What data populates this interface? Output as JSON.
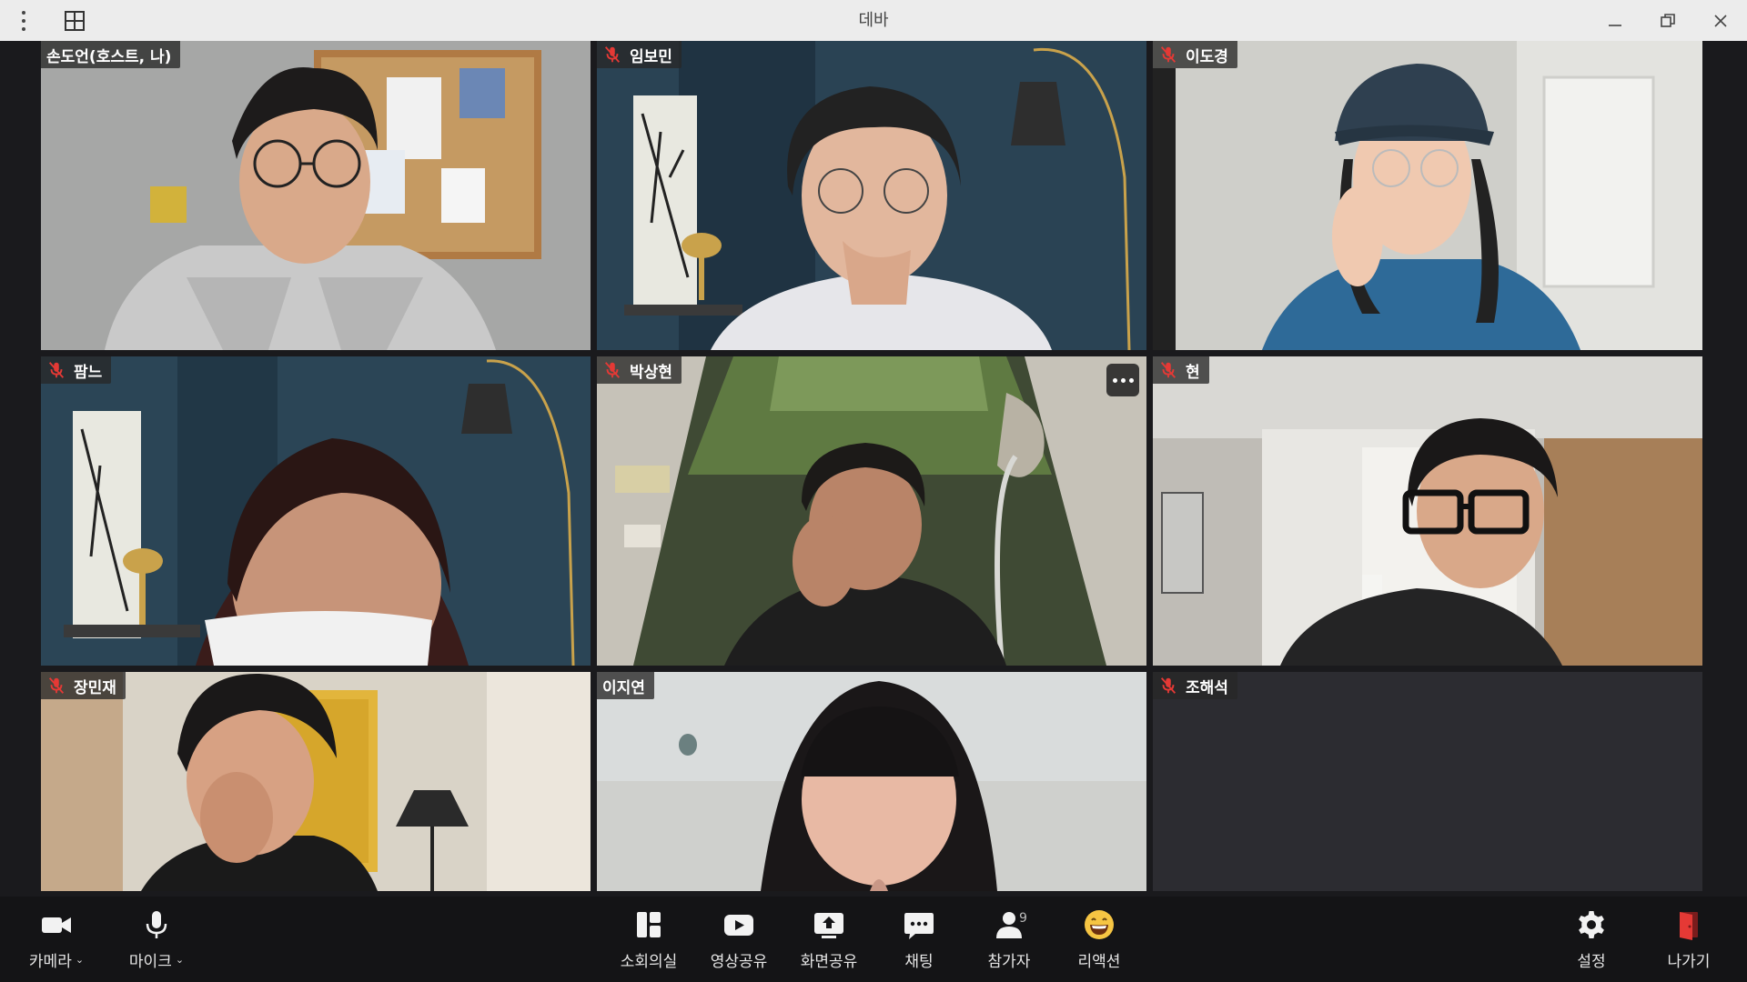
{
  "window": {
    "title": "데바"
  },
  "participants": [
    {
      "name": "손도언(호스트, 나)",
      "muted": false
    },
    {
      "name": "임보민",
      "muted": true
    },
    {
      "name": "이도경",
      "muted": true
    },
    {
      "name": "팜느",
      "muted": true
    },
    {
      "name": "박상현",
      "muted": true
    },
    {
      "name": "현",
      "muted": true
    },
    {
      "name": "장민재",
      "muted": true
    },
    {
      "name": "이지연",
      "muted": false
    },
    {
      "name": "조해석",
      "muted": true
    }
  ],
  "toolbar": {
    "camera_label": "카메라",
    "mic_label": "마이크",
    "breakout_label": "소회의실",
    "video_share_label": "영상공유",
    "screen_share_label": "화면공유",
    "chat_label": "채팅",
    "participants_label": "참가자",
    "participants_count": "9",
    "reactions_label": "리액션",
    "settings_label": "설정",
    "leave_label": "나가기"
  },
  "colors": {
    "muted_icon": "#e53935",
    "leave_icon": "#e53935",
    "reaction_icon": "#f6c543"
  }
}
